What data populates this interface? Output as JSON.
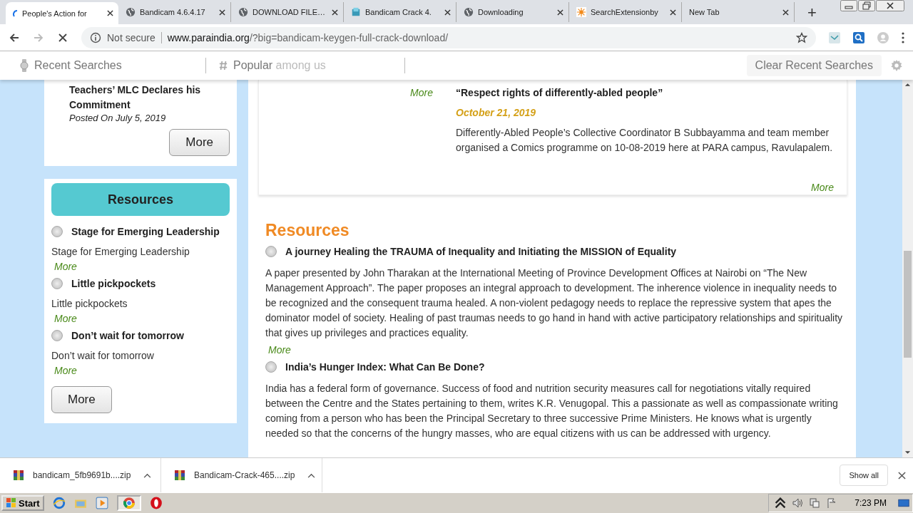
{
  "browser": {
    "tabs": [
      {
        "title": "People's Action for",
        "kind": "loading",
        "selected": true
      },
      {
        "title": "Bandicam 4.6.4.17",
        "kind": "web",
        "selected": false
      },
      {
        "title": "DOWNLOAD FILE…",
        "kind": "web",
        "selected": false
      },
      {
        "title": "Bandicam Crack 4.",
        "kind": "app",
        "selected": false
      },
      {
        "title": "Downloading",
        "kind": "web",
        "selected": false
      },
      {
        "title": "SearchExtensionby",
        "kind": "extension",
        "selected": false
      },
      {
        "title": "New Tab",
        "kind": "blank",
        "selected": false
      }
    ],
    "new_tab": "+",
    "address": {
      "security": "Not secure",
      "host": "www.paraindia.org",
      "path": "/?big=bandicam-keygen-full-crack-download/"
    }
  },
  "search_bar": {
    "recent": "Recent Searches",
    "popular": "Popular",
    "popular_suffix": "among us",
    "clear": "Clear Recent Searches"
  },
  "sidebar": {
    "post": {
      "title": "Teachers’ MLC Declares his Commitment",
      "posted": "Posted On July 5, 2019",
      "button": "More"
    },
    "resources": {
      "heading": "Resources",
      "items": [
        {
          "title": "Stage for Emerging Leadership",
          "text": "Stage for Emerging Leadership",
          "more": "More"
        },
        {
          "title": "Little pickpockets",
          "text": "Little pickpockets",
          "more": "More"
        },
        {
          "title": "Don’t wait for tomorrow",
          "text": "Don’t wait for tomorrow",
          "more": "More"
        }
      ],
      "button": "More"
    }
  },
  "main": {
    "news": {
      "more_left": "More",
      "title": "“Respect rights of differently-abled people”",
      "date": "October 21, 2019",
      "text": "Differently-Abled People’s Collective Coordinator B Subbayamma and team member organised a Comics programme on 10-08-2019 here at PARA campus, Ravulapalem.",
      "more": "More"
    },
    "resources": {
      "heading": "Resources",
      "items": [
        {
          "title": "A journey Healing the TRAUMA of Inequality and Initiating the MISSION of Equality",
          "text": "A paper presented by John Tharakan at the International Meeting of Province Development Offices at Nairobi on “The New Management Approach”. The paper proposes an integral approach to development. The inherence violence in inequality needs to be recognized and the consequent trauma healed. A non-violent pedagogy needs to replace the repressive system that apes the dominator model of society. Healing of past traumas needs to go hand in hand with active participatory relationships and spirituality that gives up privileges and practices equality.",
          "more": "More"
        },
        {
          "title": "India’s Hunger Index: What Can Be Done?",
          "text": "India has a federal form of governance. Success of food and nutrition security measures call for negotiations vitally required between the Centre and the States pertaining to them, writes K.R. Venugopal. This a passionate as well as compassionate writing coming from a person who has been the Principal Secretary to three successive Prime Ministers. He knows what is urgently needed so that the concerns of the hungry masses, who are equal citizens with us can be addressed with urgency."
        }
      ]
    }
  },
  "downloads": {
    "items": [
      {
        "name": "bandicam_5fb9691b....zip"
      },
      {
        "name": "Bandicam-Crack-465....zip"
      }
    ],
    "show_all": "Show all"
  },
  "taskbar": {
    "start": "Start",
    "clock": "7:23 PM"
  }
}
